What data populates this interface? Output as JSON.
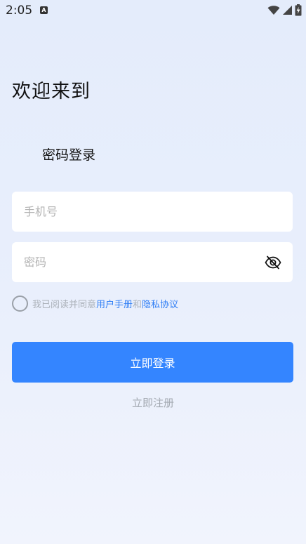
{
  "status_bar": {
    "time": "2:05",
    "notification_glyph": "A",
    "icons": [
      "wifi-icon",
      "signal-icon",
      "battery-charging-icon"
    ]
  },
  "welcome_text": "欢迎来到",
  "login_mode_title": "密码登录",
  "phone_field": {
    "placeholder": "手机号",
    "value": ""
  },
  "password_field": {
    "placeholder": "密码",
    "value": "",
    "toggle_icon": "eye-hidden-icon"
  },
  "agreement": {
    "prefix": "我已阅读并同意",
    "user_manual_link": "用户手册",
    "joiner": "和",
    "privacy_link": "隐私协议",
    "checked": false
  },
  "login_button_label": "立即登录",
  "register_link_label": "立即注册",
  "colors": {
    "accent": "#3485ff",
    "link": "#2f7ef5",
    "background": "#e6edfb",
    "muted_text": "#aab0b8"
  }
}
